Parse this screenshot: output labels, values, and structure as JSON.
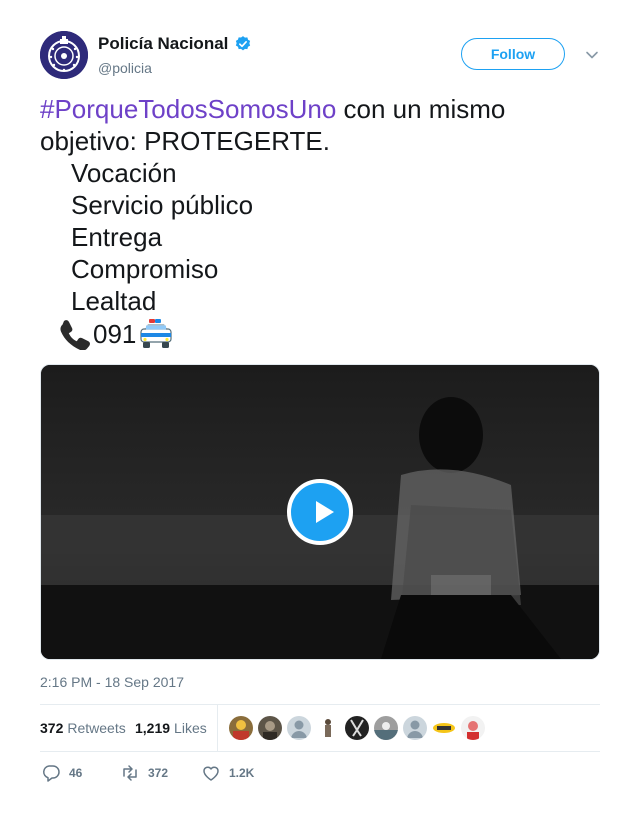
{
  "author": {
    "name": "Policía Nacional",
    "handle": "@policia",
    "verified": true,
    "avatar_color": "#2e2a7a"
  },
  "follow_label": "Follow",
  "tweet": {
    "hashtag": "#PorqueTodosSomosUno",
    "line1_rest": " con un mismo",
    "line2": "objetivo: PROTEGERTE.",
    "list": [
      "Vocación",
      "Servicio público",
      "Entrega",
      "Compromiso",
      "Lealtad"
    ],
    "phone_number": "091",
    "emojis": [
      "telephone-receiver",
      "oncoming-police-car"
    ]
  },
  "media": {
    "type": "video",
    "play_icon": "play-icon"
  },
  "timestamp": "2:16 PM - 18 Sep 2017",
  "stats": {
    "retweets_count": "372",
    "retweets_label": "Retweets",
    "likes_count": "1,219",
    "likes_label": "Likes",
    "likers_count_shown": 9
  },
  "actions": {
    "reply_count": "46",
    "retweet_count": "372",
    "like_count": "1.2K"
  },
  "colors": {
    "accent": "#1da1f2",
    "hashtag": "#6e41c8",
    "muted": "#657786"
  }
}
